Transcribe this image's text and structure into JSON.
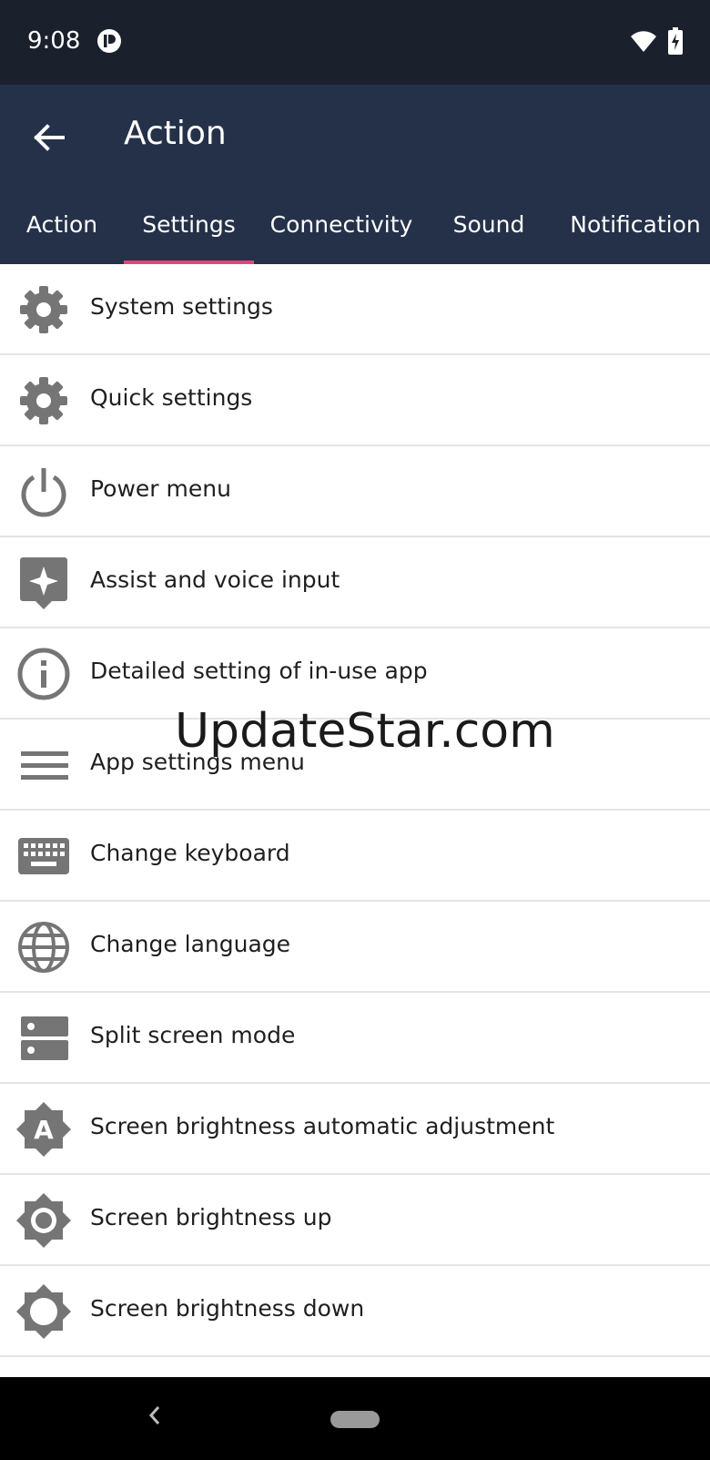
{
  "status_bar": {
    "time": "9:08"
  },
  "app_bar": {
    "title": "Action",
    "back_icon": "arrow-left-icon"
  },
  "tabs": [
    {
      "label": "Action",
      "active": false
    },
    {
      "label": "Settings",
      "active": true
    },
    {
      "label": "Connectivity",
      "active": false
    },
    {
      "label": "Sound",
      "active": false
    },
    {
      "label": "Notification",
      "active": false
    }
  ],
  "items": [
    {
      "label": "System settings",
      "icon": "gear-icon"
    },
    {
      "label": "Quick settings",
      "icon": "gear-icon"
    },
    {
      "label": "Power menu",
      "icon": "power-icon"
    },
    {
      "label": "Assist and voice input",
      "icon": "assistant-icon"
    },
    {
      "label": "Detailed setting of in-use app",
      "icon": "info-icon"
    },
    {
      "label": "App settings menu",
      "icon": "menu-icon"
    },
    {
      "label": "Change keyboard",
      "icon": "keyboard-icon"
    },
    {
      "label": "Change language",
      "icon": "globe-icon"
    },
    {
      "label": "Split screen mode",
      "icon": "split-screen-icon"
    },
    {
      "label": "Screen brightness automatic adjustment",
      "icon": "brightness-auto-icon"
    },
    {
      "label": "Screen brightness up",
      "icon": "brightness-up-icon"
    },
    {
      "label": "Screen brightness down",
      "icon": "brightness-down-icon"
    }
  ],
  "watermark": "UpdateStar.com",
  "colors": {
    "status_bar": "#1a202c",
    "app_bar": "#243149",
    "tab_indicator": "#e0467a",
    "icon": "#757575"
  }
}
